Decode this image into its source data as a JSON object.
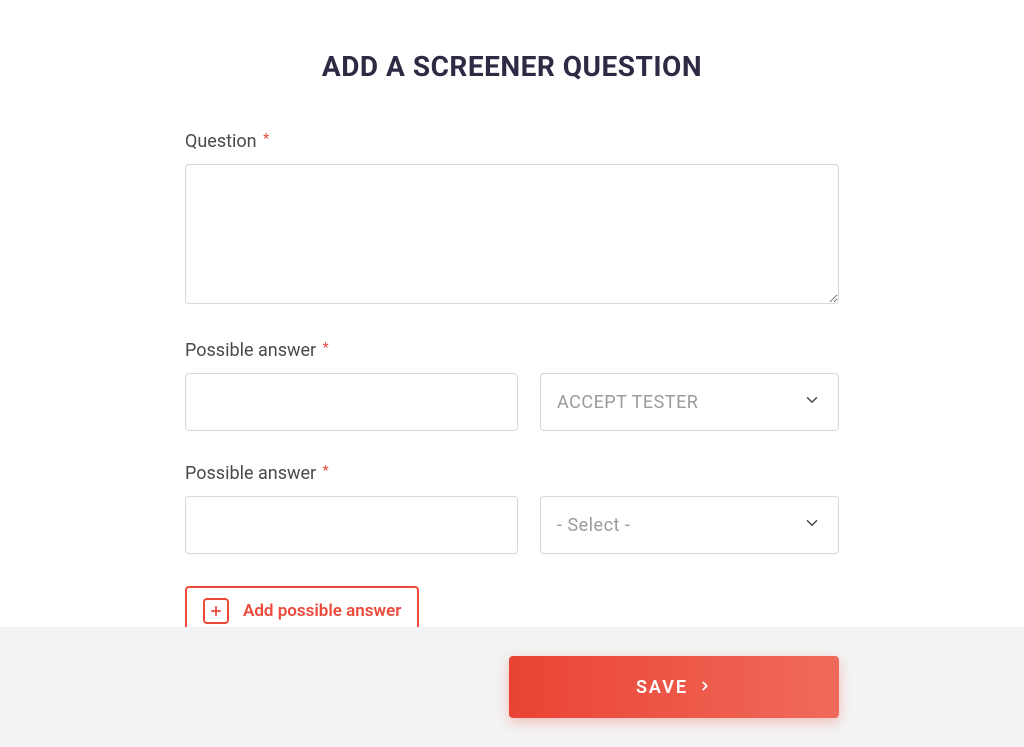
{
  "title": "ADD A SCREENER QUESTION",
  "question": {
    "label": "Question",
    "value": ""
  },
  "answers": [
    {
      "label": "Possible answer",
      "input_value": "",
      "select_value": "ACCEPT TESTER"
    },
    {
      "label": "Possible answer",
      "input_value": "",
      "select_value": "- Select -"
    }
  ],
  "add_button_label": "Add possible answer",
  "save_button_label": "SAVE"
}
